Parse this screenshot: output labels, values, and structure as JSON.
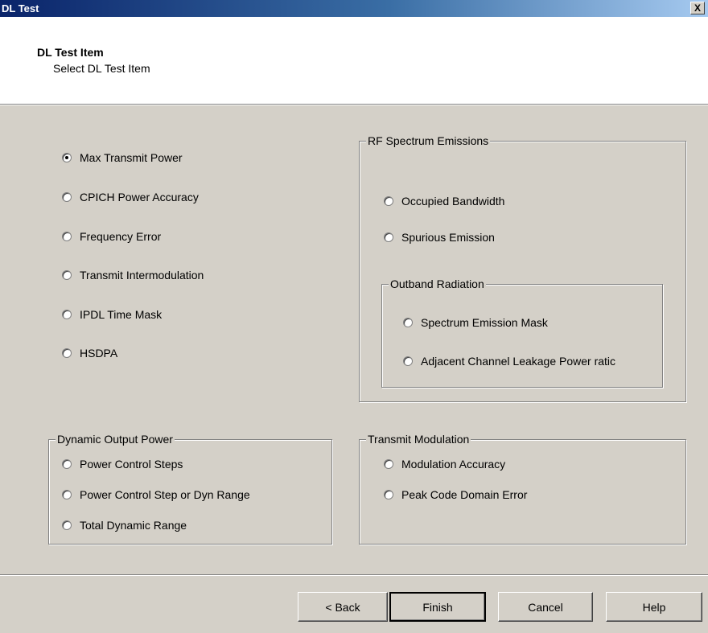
{
  "window": {
    "title": "DL Test",
    "close_label": "X"
  },
  "header": {
    "title": "DL Test Item",
    "subtitle": "Select DL Test Item"
  },
  "test_items": [
    {
      "label": "Max Transmit Power",
      "selected": true
    },
    {
      "label": "CPICH Power Accuracy",
      "selected": false
    },
    {
      "label": "Frequency Error",
      "selected": false
    },
    {
      "label": "Transmit Intermodulation",
      "selected": false
    },
    {
      "label": "IPDL Time Mask",
      "selected": false
    },
    {
      "label": "HSDPA",
      "selected": false
    }
  ],
  "rf_spectrum": {
    "legend": "RF Spectrum Emissions",
    "items": [
      {
        "label": "Occupied Bandwidth",
        "selected": false
      },
      {
        "label": "Spurious Emission",
        "selected": false
      }
    ],
    "outband": {
      "legend": "Outband Radiation",
      "items": [
        {
          "label": "Spectrum Emission Mask",
          "selected": false
        },
        {
          "label": "Adjacent Channel Leakage Power ratic",
          "selected": false
        }
      ]
    }
  },
  "dynamic_output": {
    "legend": "Dynamic Output Power",
    "items": [
      {
        "label": "Power Control Steps",
        "selected": false
      },
      {
        "label": "Power Control Step or Dyn Range",
        "selected": false
      },
      {
        "label": "Total Dynamic Range",
        "selected": false
      }
    ]
  },
  "transmit_modulation": {
    "legend": "Transmit Modulation",
    "items": [
      {
        "label": "Modulation Accuracy",
        "selected": false
      },
      {
        "label": "Peak Code Domain Error",
        "selected": false
      }
    ]
  },
  "buttons": {
    "back": "< Back",
    "finish": "Finish",
    "cancel": "Cancel",
    "help": "Help"
  }
}
